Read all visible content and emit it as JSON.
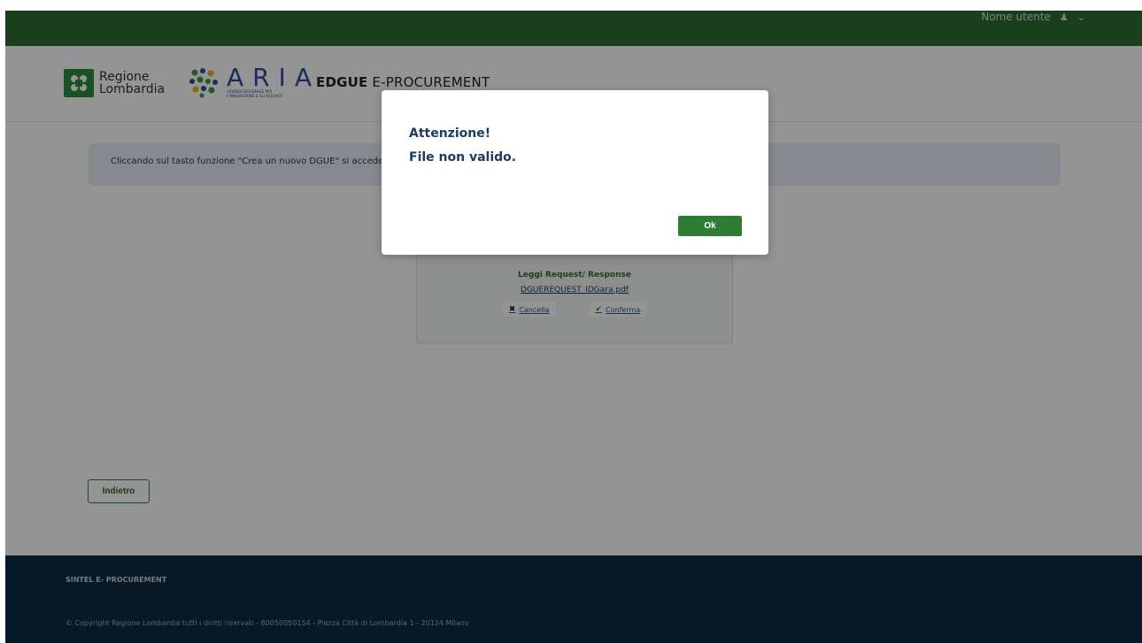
{
  "topbar": {
    "username": "Nome utente",
    "user_icon": "user-icon",
    "caret_icon": "chevron-down-icon"
  },
  "header": {
    "logo_rl_line1": "Regione",
    "logo_rl_line2": "Lombardia",
    "logo_aria_word": "ARIA",
    "logo_aria_sub1": "AZIENDA REGIONALE PER",
    "logo_aria_sub2": "L'INNOVAZIONE E GLI ACQUISTI",
    "app_title_bold": "EDGUE",
    "app_title_rest": "E-PROCUREMENT"
  },
  "main": {
    "info_text": "Cliccando sul tasto funzione \"Crea un nuovo DGUE\" si accede",
    "upload": {
      "title": "Leggi Request/ Response",
      "filename": "DGUEREQUEST_IDGara.pdf",
      "cancel_label": "Cancella",
      "confirm_label": "Conferma"
    },
    "back_label": "Indietro"
  },
  "footer": {
    "title": "SINTEL E- PROCUREMENT",
    "copyright": "© Copyright Regione Lombardia tutti i diritti riservati - 80050050154 - Piazza Città di Lombardia 1 - 20124 Milano"
  },
  "modal": {
    "title": "Attenzione!",
    "message": "File non valido.",
    "ok_label": "Ok"
  },
  "colors": {
    "green": "#2d6b35",
    "navy": "#0d2a42",
    "info_bg": "#e7edf4",
    "ok_green": "#2e7d35"
  }
}
